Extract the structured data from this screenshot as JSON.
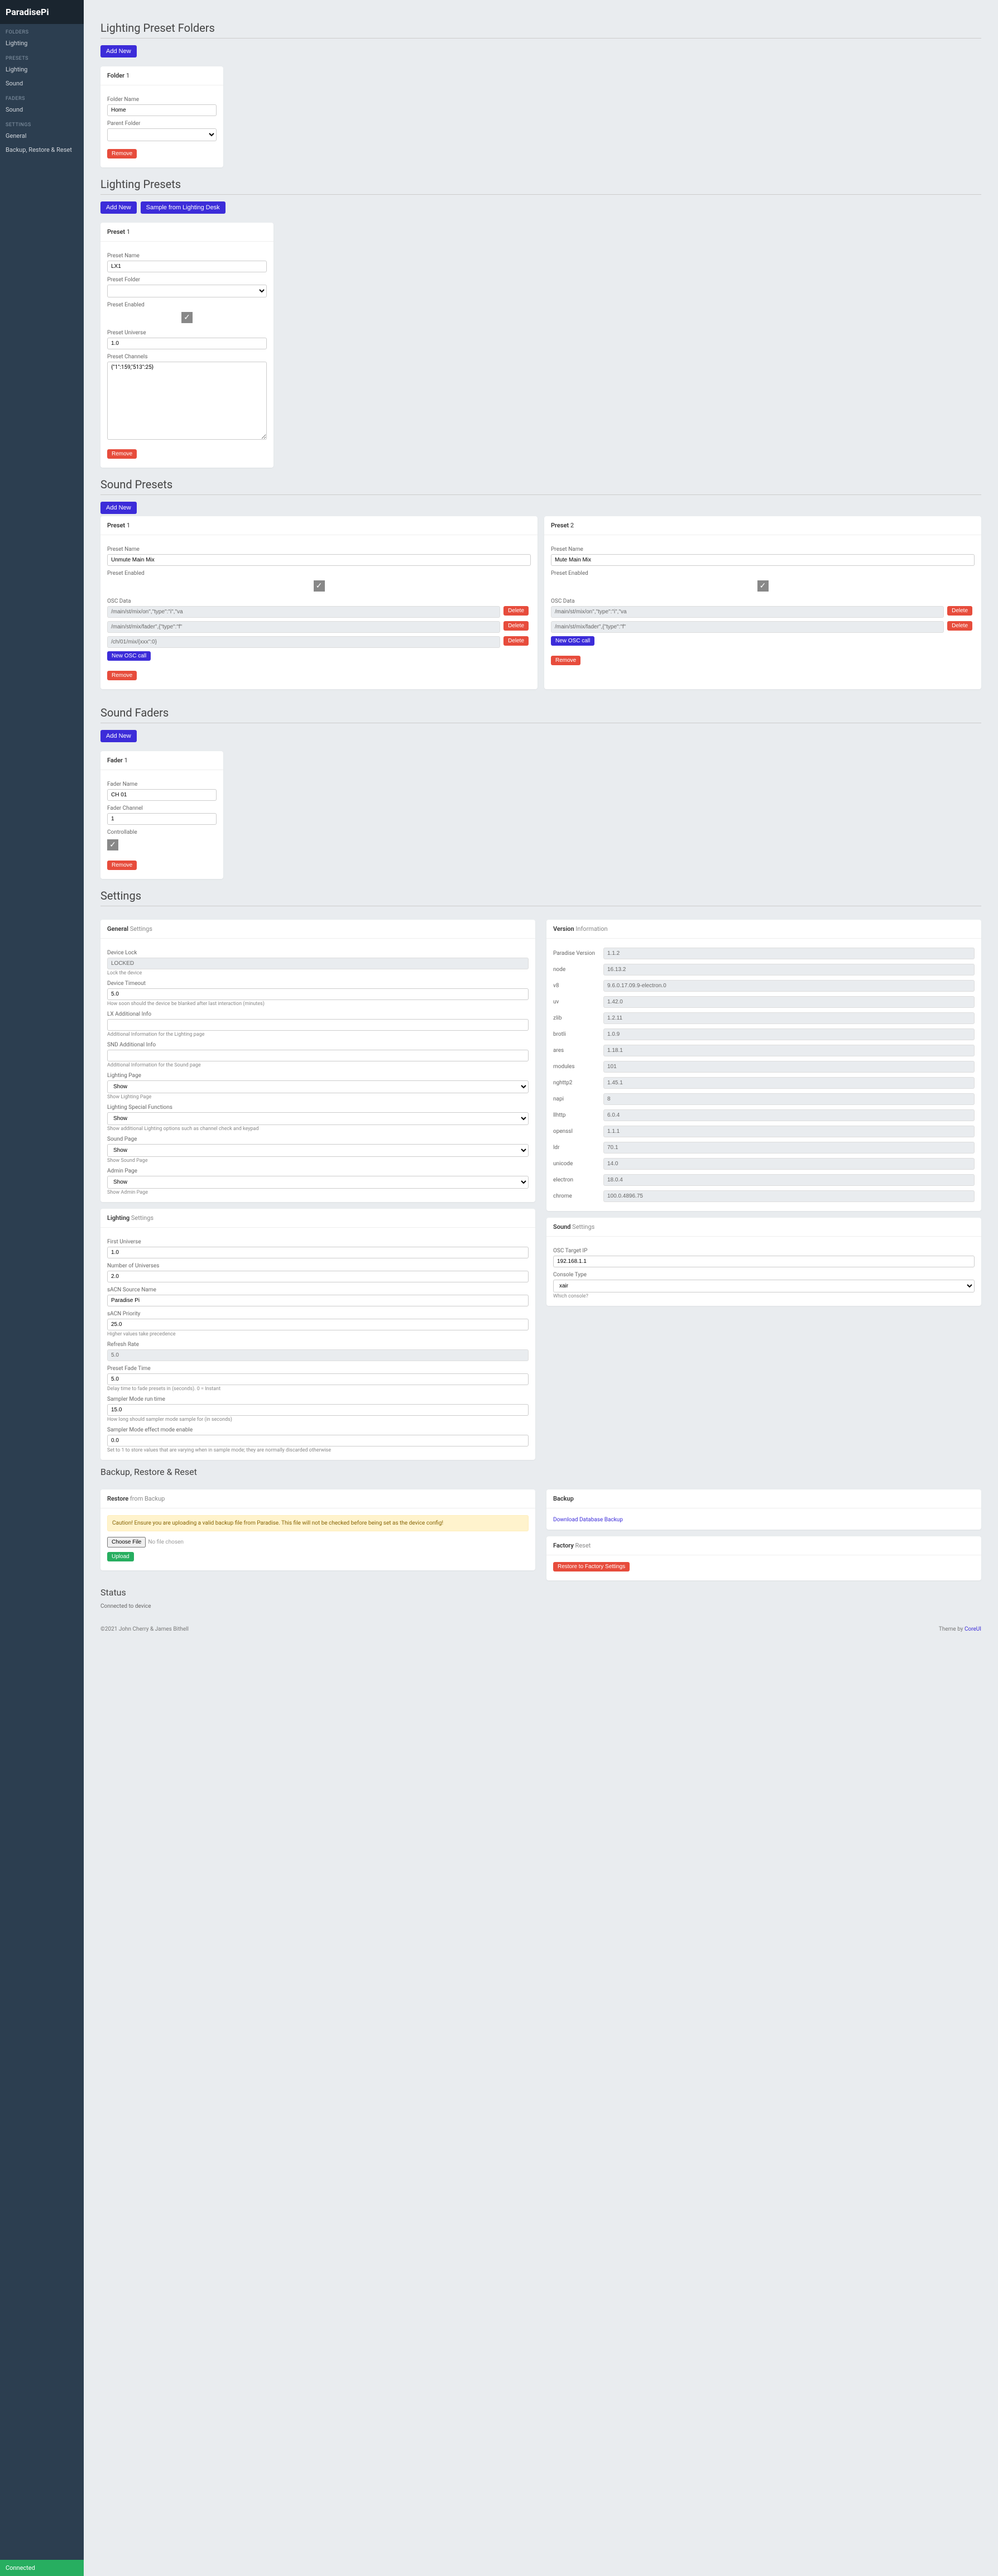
{
  "app_title": "ParadisePi",
  "sidebar": {
    "sections": [
      {
        "label": "FOLDERS",
        "items": [
          "Lighting"
        ]
      },
      {
        "label": "PRESETS",
        "items": [
          "Lighting",
          "Sound"
        ]
      },
      {
        "label": "FADERS",
        "items": [
          "Sound"
        ]
      },
      {
        "label": "SETTINGS",
        "items": [
          "General",
          "Backup, Restore & Reset"
        ]
      }
    ],
    "status": "Connected"
  },
  "lighting_folders": {
    "title": "Lighting Preset Folders",
    "add_btn": "Add New",
    "folder": {
      "title_prefix": "Folder",
      "num": "1",
      "name_label": "Folder Name",
      "name_value": "Home",
      "parent_label": "Parent Folder",
      "remove": "Remove"
    }
  },
  "lighting_presets": {
    "title": "Lighting Presets",
    "add_btn": "Add New",
    "sample_btn": "Sample from Lighting Desk",
    "preset": {
      "title_prefix": "Preset",
      "num": "1",
      "name_label": "Preset Name",
      "name_value": "LX1",
      "folder_label": "Preset Folder",
      "enabled_label": "Preset Enabled",
      "universe_label": "Preset Universe",
      "universe_value": "1.0",
      "channels_label": "Preset Channels",
      "channels_value": "{\"1\":159,\"513\":25}",
      "remove": "Remove"
    }
  },
  "sound_presets": {
    "title": "Sound Presets",
    "add_btn": "Add New",
    "presets": [
      {
        "num": "1",
        "name_value": "Unmute Main Mix",
        "osc_rows": [
          {
            "val": "/main/st/mix/on\",\"type\":\"i\",\"va",
            "has_delete": true
          },
          {
            "val": "/main/st/mix/fader\",{\"type\":\"f\"",
            "has_delete": true
          },
          {
            "val": "/ch/01/mix/{xxx\":0}",
            "has_delete": true
          }
        ],
        "show_new": true
      },
      {
        "num": "2",
        "name_value": "Mute Main Mix",
        "osc_rows": [
          {
            "val": "/main/st/mix/on\",\"type\":\"i\",\"va",
            "has_delete": true
          },
          {
            "val": "/main/st/mix/fader\",{\"type\":\"f\"",
            "has_delete": true
          }
        ],
        "show_new": true
      }
    ],
    "labels": {
      "title_prefix": "Preset",
      "name_label": "Preset Name",
      "enabled_label": "Preset Enabled",
      "osc_label": "OSC Data",
      "delete": "Delete",
      "new_call": "New OSC call",
      "remove": "Remove"
    }
  },
  "sound_faders": {
    "title": "Sound Faders",
    "add_btn": "Add New",
    "fader": {
      "title_prefix": "Fader",
      "num": "1",
      "name_label": "Fader Name",
      "name_value": "CH 01",
      "channel_label": "Fader Channel",
      "channel_value": "1",
      "controllable_label": "Controllable",
      "remove": "Remove"
    }
  },
  "settings": {
    "title": "Settings",
    "general": {
      "header_bold": "General",
      "header_light": "Settings",
      "lock_label": "Device Lock",
      "lock_value": "LOCKED",
      "lock_help": "Lock the device",
      "timeout_label": "Device Timeout",
      "timeout_value": "5.0",
      "timeout_help": "How soon should the device be blanked after last interaction (minutes)",
      "lx_add_label": "LX Additional Info",
      "lx_add_help": "Additional Information for the Lighting page",
      "snd_add_label": "SND Additional Info",
      "snd_add_help": "Additional Information for the Sound page",
      "lighting_page_label": "Lighting Page",
      "lighting_page_value": "Show",
      "lighting_page_help": "Show Lighting Page",
      "lighting_special_label": "Lighting Special Functions",
      "lighting_special_value": "Show",
      "lighting_special_help": "Show additional Lighting options such as channel check and keypad",
      "sound_page_label": "Sound Page",
      "sound_page_value": "Show",
      "sound_page_help": "Show Sound Page",
      "admin_page_label": "Admin Page",
      "admin_page_value": "Show",
      "admin_page_help": "Show Admin Page"
    },
    "version": {
      "header_bold": "Version",
      "header_light": "Information",
      "rows": [
        {
          "label": "Paradise Version",
          "value": "1.1.2"
        },
        {
          "label": "node",
          "value": "16.13.2"
        },
        {
          "label": "v8",
          "value": "9.6.0.17.09.9-electron.0"
        },
        {
          "label": "uv",
          "value": "1.42.0"
        },
        {
          "label": "zlib",
          "value": "1.2.11"
        },
        {
          "label": "brotli",
          "value": "1.0.9"
        },
        {
          "label": "ares",
          "value": "1.18.1"
        },
        {
          "label": "modules",
          "value": "101"
        },
        {
          "label": "nghttp2",
          "value": "1.45.1"
        },
        {
          "label": "napi",
          "value": "8"
        },
        {
          "label": "llhttp",
          "value": "6.0.4"
        },
        {
          "label": "openssl",
          "value": "1.1.1"
        },
        {
          "label": "ldr",
          "value": "70.1"
        },
        {
          "label": "unicode",
          "value": "14.0"
        },
        {
          "label": "electron",
          "value": "18.0.4"
        },
        {
          "label": "chrome",
          "value": "100.0.4896.75"
        }
      ]
    },
    "lighting": {
      "header_bold": "Lighting",
      "header_light": "Settings",
      "first_universe_label": "First Universe",
      "first_universe_value": "1.0",
      "num_universes_label": "Number of Universes",
      "num_universes_value": "2.0",
      "source_name_label": "sACN Source Name",
      "source_name_value": "Paradise Pi",
      "priority_label": "sACN Priority",
      "priority_value": "25.0",
      "priority_help": "Higher values take precedence",
      "refresh_label": "Refresh Rate",
      "refresh_value": "5.0",
      "fade_label": "Preset Fade Time",
      "fade_value": "5.0",
      "fade_help": "Delay time to fade presets in (seconds). 0 = Instant",
      "sampler_run_label": "Sampler Mode run time",
      "sampler_run_value": "15.0",
      "sampler_run_help": "How long should sampler mode sample for (in seconds)",
      "sampler_effect_label": "Sampler Mode effect mode enable",
      "sampler_effect_value": "0.0",
      "sampler_effect_help": "Set to 1 to store values that are varying when in sample mode; they are normally discarded otherwise"
    },
    "sound": {
      "header_bold": "Sound",
      "header_light": "Settings",
      "ip_label": "OSC Target IP",
      "ip_value": "192.168.1.1",
      "console_label": "Console Type",
      "console_value": "xair",
      "console_help": "Which console?"
    }
  },
  "backup": {
    "title": "Backup, Restore & Reset",
    "restore": {
      "header_bold": "Restore",
      "header_light": "from Backup",
      "warning": "Caution! Ensure you are uploading a valid backup file from Paradise. This file will not be checked before being set as the device config!",
      "choose": "Choose File",
      "nofile": "No file chosen",
      "upload": "Upload"
    },
    "download": {
      "header": "Backup",
      "link": "Download Database Backup"
    },
    "factory": {
      "header_bold": "Factory",
      "header_light": "Reset",
      "btn": "Restore to Factory Settings"
    }
  },
  "status": {
    "title": "Status",
    "text": "Connected to device"
  },
  "footer": {
    "copyright": "©2021 John Cherry & James Bithell",
    "theme_prefix": "Theme by ",
    "theme_link": "CoreUI"
  }
}
